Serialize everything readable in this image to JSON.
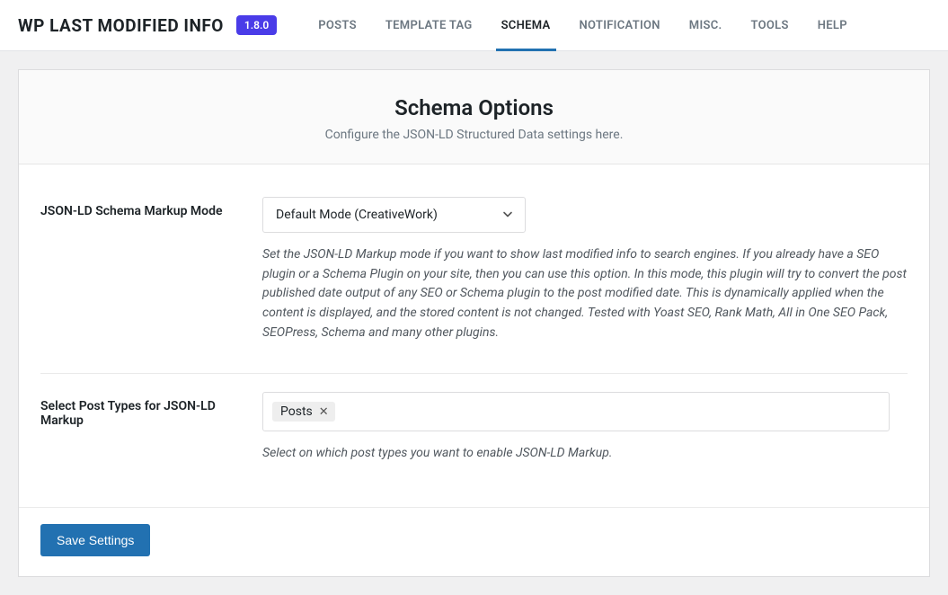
{
  "header": {
    "plugin_name": "WP LAST MODIFIED INFO",
    "version": "1.8.0",
    "tabs": [
      {
        "label": "POSTS",
        "active": false
      },
      {
        "label": "TEMPLATE TAG",
        "active": false
      },
      {
        "label": "SCHEMA",
        "active": true
      },
      {
        "label": "NOTIFICATION",
        "active": false
      },
      {
        "label": "MISC.",
        "active": false
      },
      {
        "label": "TOOLS",
        "active": false
      },
      {
        "label": "HELP",
        "active": false
      }
    ]
  },
  "panel": {
    "title": "Schema Options",
    "subtitle": "Configure the JSON-LD Structured Data settings here."
  },
  "fields": {
    "markup_mode": {
      "label": "JSON-LD Schema Markup Mode",
      "value": "Default Mode (CreativeWork)",
      "help": "Set the JSON-LD Markup mode if you want to show last modified info to search engines. If you already have a SEO plugin or a Schema Plugin on your site, then you can use this option. In this mode, this plugin will try to convert the post published date output of any SEO or Schema plugin to the post modified date. This is dynamically applied when the content is displayed, and the stored content is not changed. Tested with Yoast SEO, Rank Math, All in One SEO Pack, SEOPress, Schema and many other plugins."
    },
    "post_types": {
      "label": "Select Post Types for JSON-LD Markup",
      "selected": [
        {
          "text": "Posts"
        }
      ],
      "help": "Select on which post types you want to enable JSON-LD Markup."
    }
  },
  "actions": {
    "save_label": "Save Settings"
  }
}
